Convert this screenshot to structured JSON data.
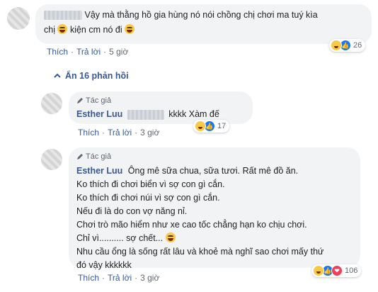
{
  "comment1": {
    "line1": "Vậy mà thằng hồ gia hùng nó nói chồng chị chơi ma tuý kìa",
    "line2a": "chị",
    "line2b": "kiện cm nó đi",
    "like": "Thích",
    "reply": "Trả lời",
    "dot": "·",
    "time": "5 giờ",
    "reaction_count": "26"
  },
  "replies_toggle": {
    "label": "Ẩn 16 phản hồi"
  },
  "reply1": {
    "tag": "Tác giả",
    "name": "Esther Luu",
    "text": "kkkk Xàm đế",
    "like": "Thích",
    "reply": "Trả lời",
    "dot": "·",
    "time": "3 giờ",
    "reaction_count": "17"
  },
  "reply2": {
    "tag": "Tác giả",
    "name": "Esther Luu",
    "line1": "Ông mê sữa chua, sữa tươi. Rất mê đồ ăn.",
    "line2": "Ko thích đi chơi biển vì sợ con gì cắn.",
    "line3": "Ko thích đi chơi núi vì sợ con gì cắn.",
    "line4": "Nếu đi là do con vợ năng nỉ.",
    "line5": "Chơi trò mão hiểm như xe cao tốc chẳng hạn ko chịu chơi.",
    "line6": "Chỉ vì.......... sợ chết...",
    "line7": "Nhu cầu ổng là sống rất lâu và khoẻ mà nghĩ sao chơi mấy thứ",
    "line8": "đó vậy kkkkkk",
    "like": "Thích",
    "reply": "Trả lời",
    "dot": "·",
    "time": "3 giờ",
    "reaction_count": "106"
  }
}
